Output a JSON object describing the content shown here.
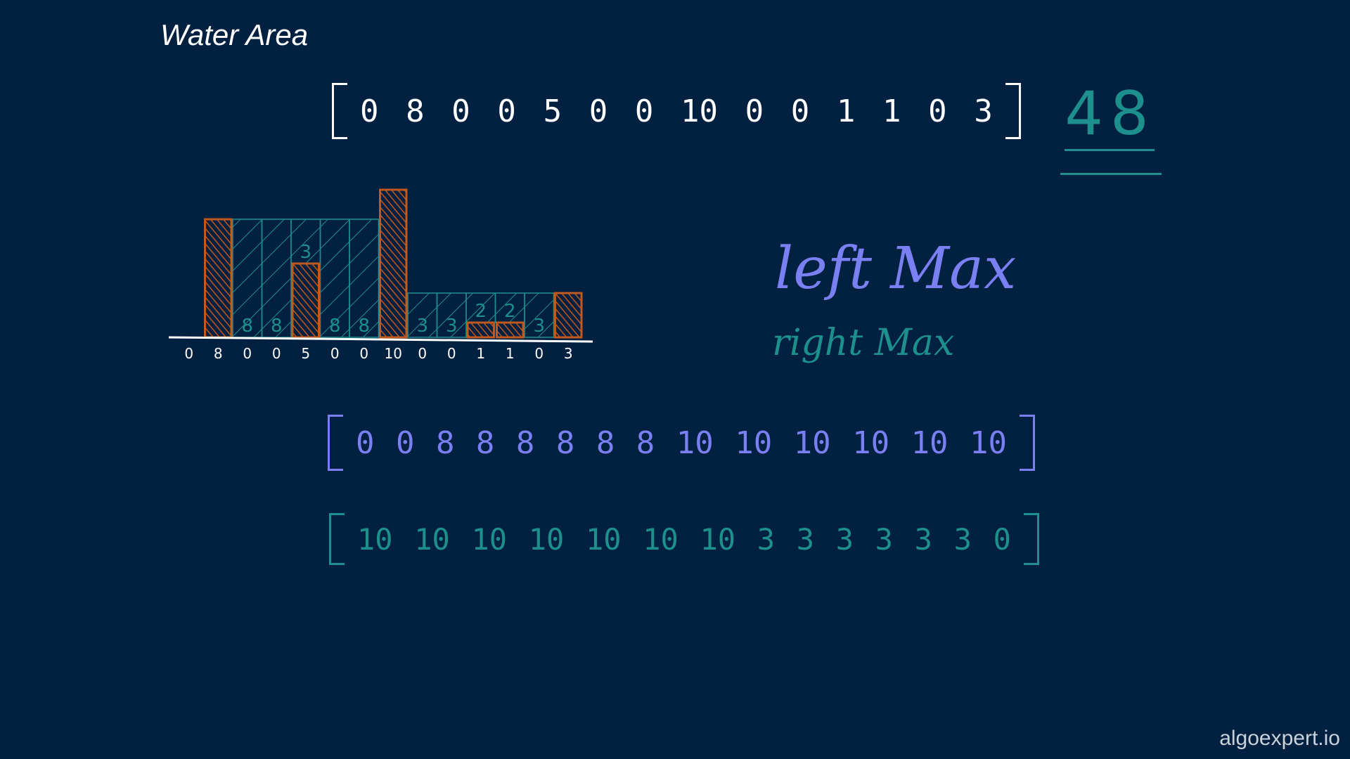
{
  "title": "Water Area",
  "input_array": [
    "0",
    "8",
    "0",
    "0",
    "5",
    "0",
    "0",
    "10",
    "0",
    "0",
    "1",
    "1",
    "0",
    "3"
  ],
  "answer": "48",
  "labels": {
    "left_max": "left Max",
    "right_max": "right Max"
  },
  "left_max_array": [
    "0",
    "0",
    "8",
    "8",
    "8",
    "8",
    "8",
    "8",
    "10",
    "10",
    "10",
    "10",
    "10",
    "10"
  ],
  "right_max_array": [
    "10",
    "10",
    "10",
    "10",
    "10",
    "10",
    "10",
    "3",
    "3",
    "3",
    "3",
    "3",
    "3",
    "0"
  ],
  "chart_data": {
    "type": "bar",
    "categories": [
      "0",
      "8",
      "0",
      "0",
      "5",
      "0",
      "0",
      "10",
      "0",
      "0",
      "1",
      "1",
      "0",
      "3"
    ],
    "series": [
      {
        "values": [
          0,
          8,
          0,
          0,
          5,
          0,
          0,
          10,
          0,
          0,
          1,
          1,
          0,
          3
        ]
      },
      {
        "values": [
          0,
          0,
          8,
          8,
          3,
          8,
          8,
          0,
          3,
          3,
          2,
          2,
          3,
          0
        ]
      }
    ],
    "water_labels": [
      "",
      "",
      "8",
      "8",
      "3",
      "8",
      "8",
      "",
      "3",
      "3",
      "2",
      "2",
      "3",
      ""
    ],
    "ylim": [
      0,
      10
    ],
    "colors": {
      "bars": "#c2581e",
      "water": "#1d8f8d",
      "axis": "#ffffff"
    }
  },
  "watermark": "algoexpert.io"
}
